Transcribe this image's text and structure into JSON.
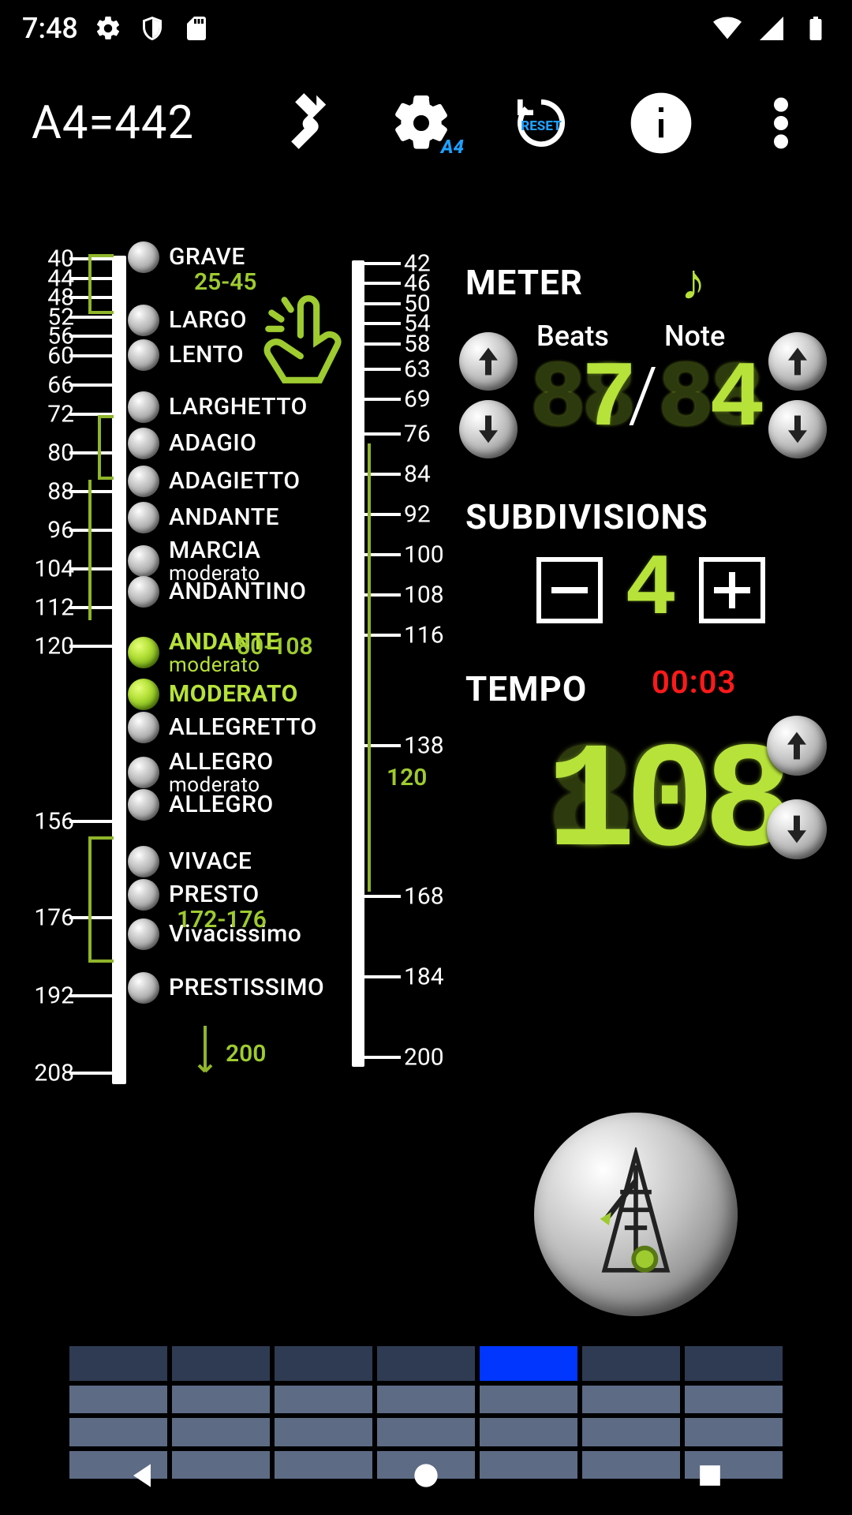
{
  "status": {
    "time": "7:48"
  },
  "appbar": {
    "title": "A4=442",
    "reset_label": "RESET",
    "a4_badge": "A4"
  },
  "tempo_markings": {
    "ranges": {
      "largo": "25-45",
      "andantino": "80-108",
      "vivacissimo": "172-176",
      "prestissimo": "200",
      "moderato_cur": "120"
    },
    "items": [
      {
        "label": "GRAVE"
      },
      {
        "label": "LARGO"
      },
      {
        "label": "LENTO"
      },
      {
        "label": "LARGHETTO"
      },
      {
        "label": "ADAGIO"
      },
      {
        "label": "ADAGIETTO"
      },
      {
        "label": "ANDANTE"
      },
      {
        "label": "MARCIA",
        "sub": "moderato"
      },
      {
        "label": "ANDANTINO"
      },
      {
        "label": "ANDANTE",
        "sub": "moderato",
        "selected": true
      },
      {
        "label": "MODERATO",
        "selected": true
      },
      {
        "label": "ALLEGRETTO"
      },
      {
        "label": "ALLEGRO",
        "sub": "moderato"
      },
      {
        "label": "ALLEGRO"
      },
      {
        "label": "VIVACE"
      },
      {
        "label": "PRESTO"
      },
      {
        "label": "Vivacissimo"
      },
      {
        "label": "PRESTISSIMO"
      }
    ],
    "left_scale": [
      40,
      44,
      48,
      52,
      56,
      60,
      66,
      72,
      80,
      88,
      96,
      104,
      112,
      120,
      156,
      176,
      192,
      208
    ],
    "right_scale": [
      42,
      46,
      50,
      54,
      58,
      63,
      69,
      76,
      84,
      92,
      100,
      108,
      116,
      138,
      168,
      184,
      200
    ]
  },
  "meter": {
    "heading": "METER",
    "beats_label": "Beats",
    "note_label": "Note",
    "ghost": "88",
    "beats_value": "7",
    "note_value": "4"
  },
  "subdivisions": {
    "heading": "SUBDIVISIONS",
    "value": "4"
  },
  "tempo": {
    "heading": "TEMPO",
    "timer": "00:03",
    "value": "108",
    "ghost": "888"
  },
  "beat_grid": {
    "cols": 7,
    "rows": 4,
    "active_col": 4
  }
}
